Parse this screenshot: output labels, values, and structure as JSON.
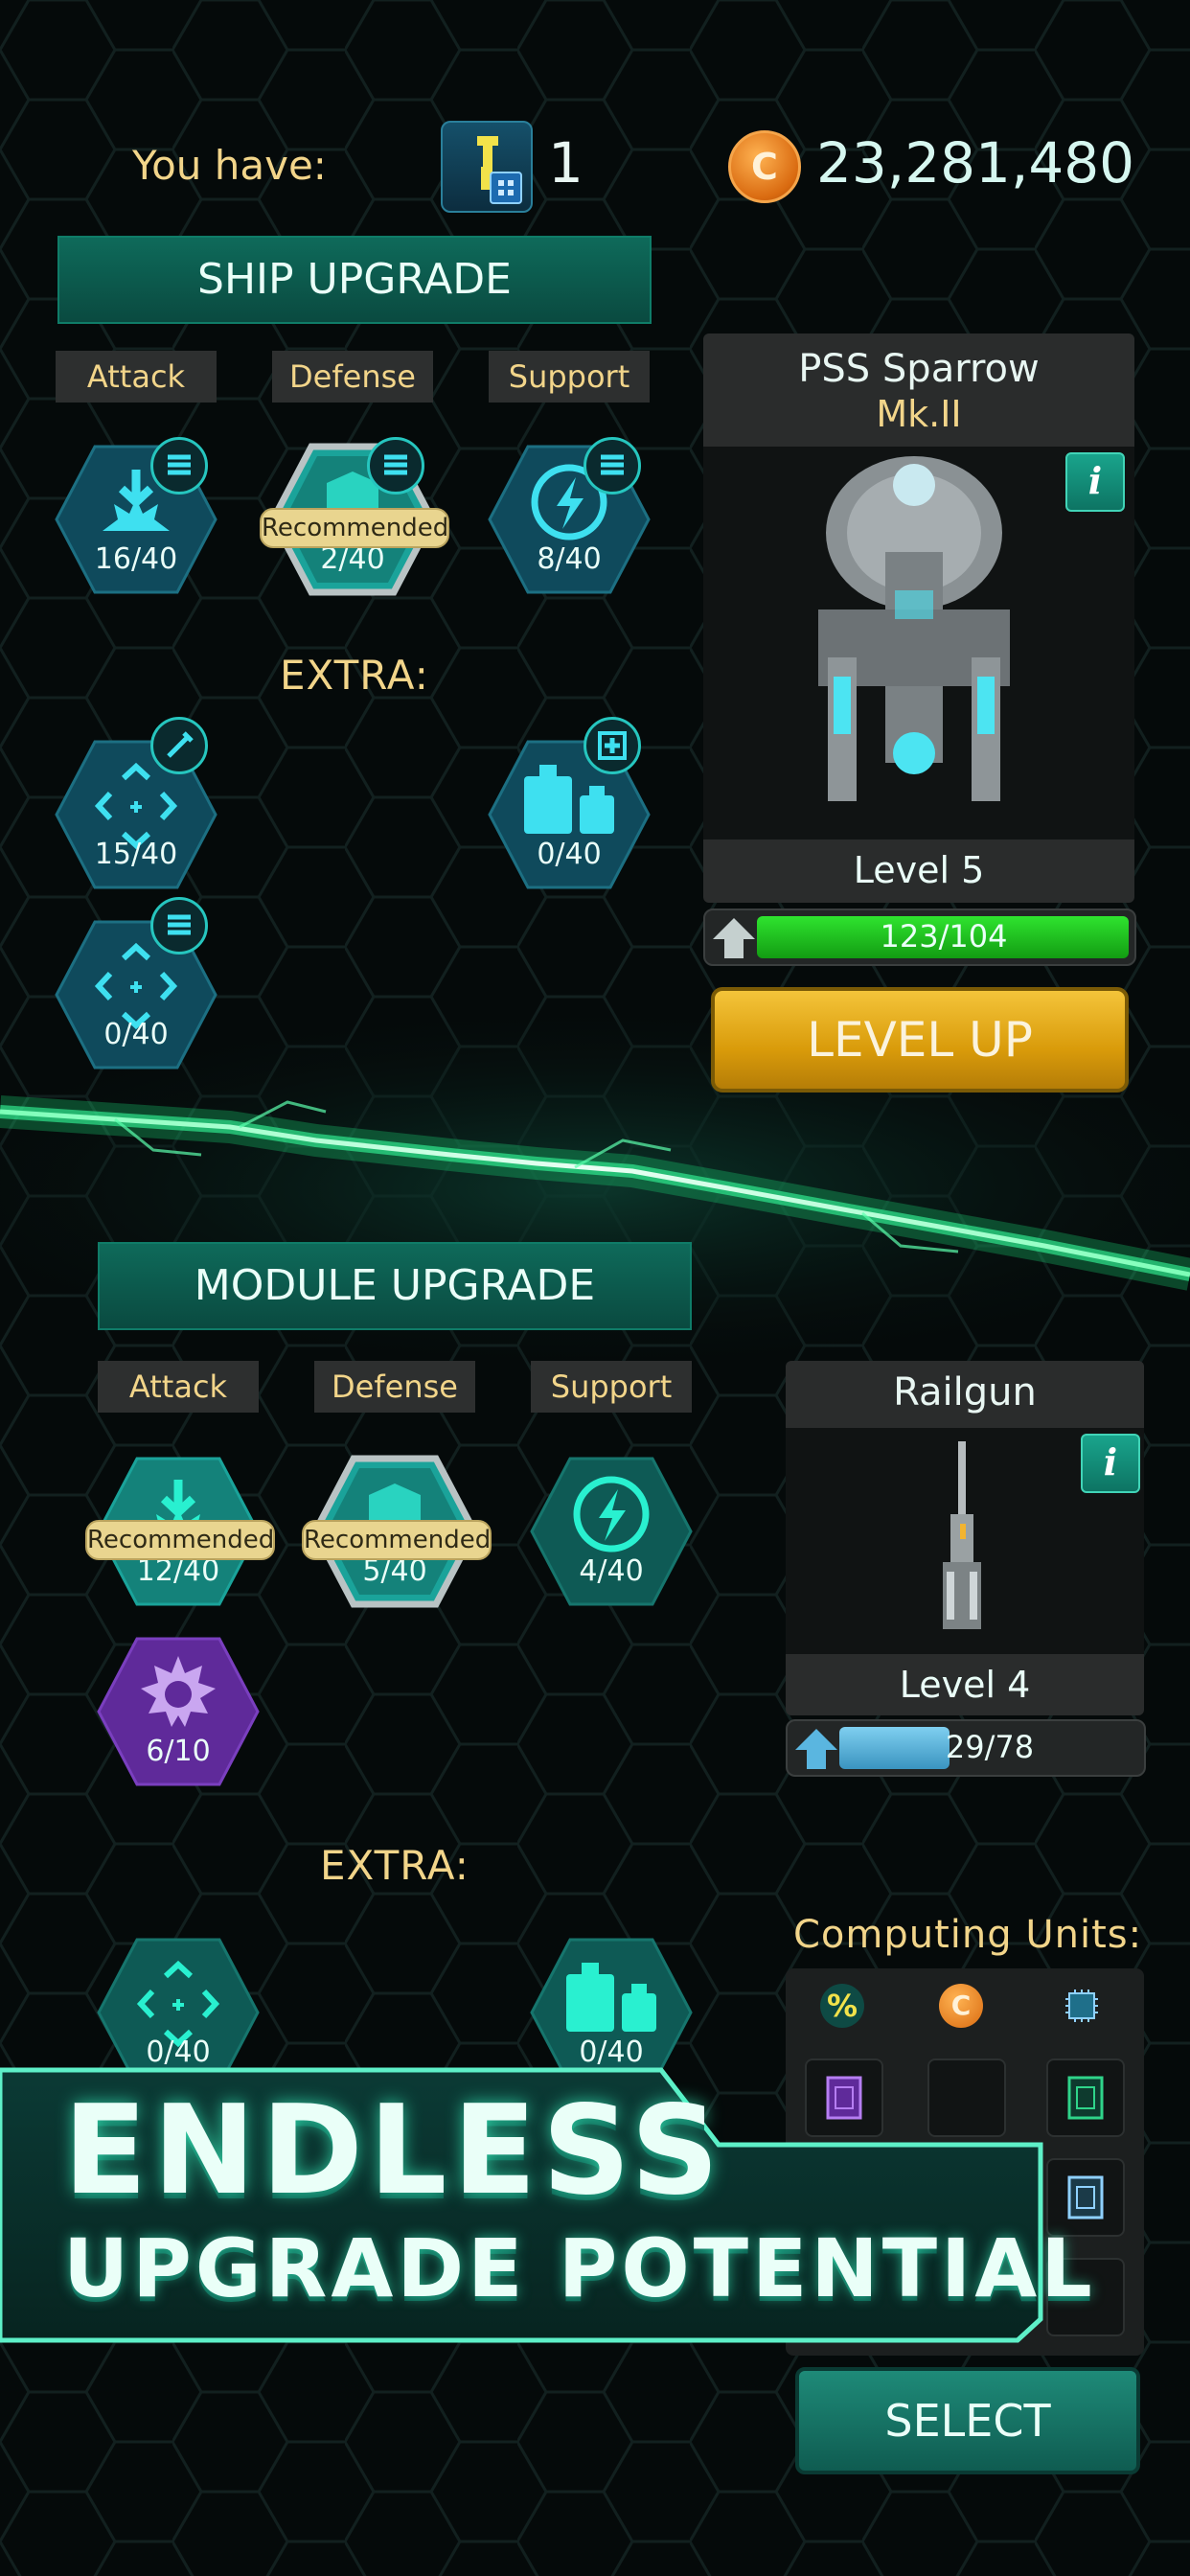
{
  "colors": {
    "accent": "#19a48c",
    "gold_text": "#f2d58a",
    "xp_green": "#1fb51f",
    "xp_blue": "#5ab6e0",
    "level_up_gold": "#e0a414",
    "purple_skill": "#6b2fa8"
  },
  "header": {
    "you_have_label": "You have:",
    "pilot_icon": "pilot-token-icon",
    "pilot_count": "1",
    "coin_icon": "coin-icon",
    "coin_symbol": "C",
    "coins": "23,281,480"
  },
  "ship_upgrade": {
    "title": "SHIP UPGRADE",
    "tabs": [
      {
        "label": "Attack"
      },
      {
        "label": "Defense"
      },
      {
        "label": "Support"
      }
    ],
    "skills": [
      {
        "icon": "explosion-icon",
        "count": "16/40",
        "recommended": false
      },
      {
        "icon": "shield-icon",
        "count": "2/40",
        "recommended": true,
        "badge": "Recommended"
      },
      {
        "icon": "lightning-icon",
        "count": "8/40",
        "recommended": false
      }
    ],
    "extra_label": "EXTRA:",
    "extra_skills": [
      {
        "icon": "crosshair-icon",
        "count": "15/40"
      },
      {
        "icon": "weights-icon",
        "count": "0/40"
      },
      {
        "icon": "crosshair-icon",
        "count": "0/40"
      }
    ]
  },
  "ship_card": {
    "name": "PSS Sparrow",
    "variant": "Mk.II",
    "info_label": "i",
    "level": "Level 5",
    "xp": "123/104",
    "xp_fraction": 1.0,
    "level_up_label": "LEVEL UP"
  },
  "module_upgrade": {
    "title": "MODULE UPGRADE",
    "tabs": [
      {
        "label": "Attack"
      },
      {
        "label": "Defense"
      },
      {
        "label": "Support"
      }
    ],
    "skills": [
      {
        "icon": "explosion-icon",
        "count": "12/40",
        "recommended": true,
        "badge": "Recommended"
      },
      {
        "icon": "shield-icon",
        "count": "5/40",
        "recommended": true,
        "badge": "Recommended"
      },
      {
        "icon": "lightning-icon",
        "count": "4/40",
        "recommended": false
      }
    ],
    "special_skill": {
      "icon": "spiky-gear-icon",
      "count": "6/10"
    },
    "extra_label": "EXTRA:",
    "extra_skills": [
      {
        "icon": "crosshair-icon",
        "count": "0/40"
      },
      {
        "icon": "weights-icon",
        "count": "0/40"
      }
    ]
  },
  "module_card": {
    "name": "Railgun",
    "info_label": "i",
    "level": "Level 4",
    "xp": "29/78",
    "xp_fraction": 0.37
  },
  "computing_units": {
    "title": "Computing Units:",
    "filter_icons": [
      "percent-icon",
      "coin-icon",
      "chip-icon"
    ],
    "percent_symbol": "%",
    "coin_symbol": "C",
    "select_label": "SELECT"
  },
  "banner": {
    "line1": "ENDLESS",
    "line2": "UPGRADE POTENTIAL"
  }
}
